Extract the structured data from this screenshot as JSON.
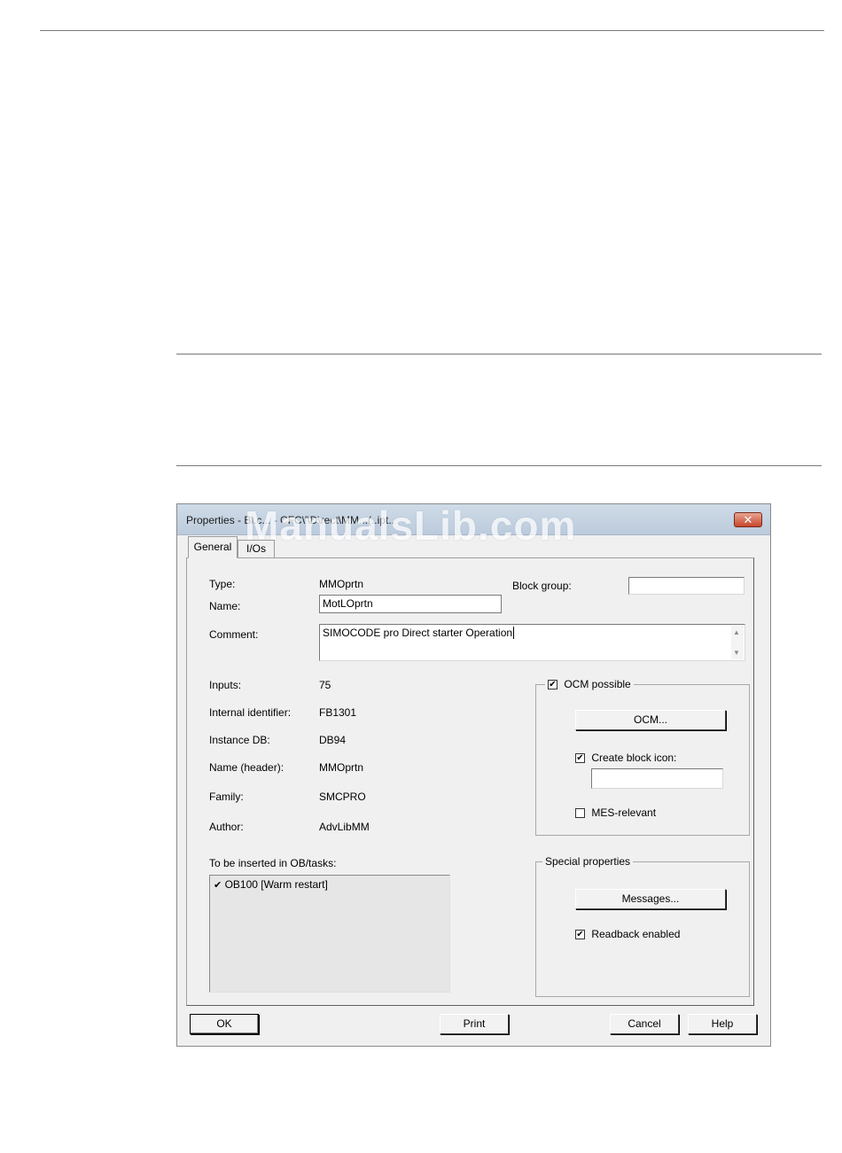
{
  "dialog": {
    "title": "Properties - Bl.c... - CFC\\'\\D\\rect\\MM...(..ipt..",
    "watermark": "ManualsLib.com",
    "close_glyph": "✕",
    "tabs": [
      {
        "label": "General"
      },
      {
        "label": "I/Os"
      }
    ],
    "fields": {
      "type_label": "Type:",
      "type_value": "MMOprtn",
      "block_group_label": "Block group:",
      "block_group_value": "",
      "name_label": "Name:",
      "name_value": "MotLOprtn",
      "comment_label": "Comment:",
      "comment_value": "SIMOCODE pro Direct starter Operation",
      "inputs_label": "Inputs:",
      "inputs_value": "75",
      "internal_id_label": "Internal identifier:",
      "internal_id_value": "FB1301",
      "instance_db_label": "Instance DB:",
      "instance_db_value": "DB94",
      "name_header_label": "Name (header):",
      "name_header_value": "MMOprtn",
      "family_label": "Family:",
      "family_value": "SMCPRO",
      "author_label": "Author:",
      "author_value": "AdvLibMM"
    },
    "ob_tasks": {
      "label": "To be inserted in OB/tasks:",
      "items": [
        "OB100 [Warm restart]"
      ],
      "check_glyph": "✔"
    },
    "ocm_group": {
      "legend": "OCM possible",
      "checked": true,
      "ocm_button": "OCM...",
      "create_block_icon_label": "Create block icon:",
      "create_block_icon_checked": true,
      "block_icon_value": "",
      "mes_relevant_label": "MES-relevant",
      "mes_relevant_checked": false
    },
    "special_group": {
      "legend": "Special properties",
      "messages_button": "Messages...",
      "readback_label": "Readback enabled",
      "readback_checked": true
    },
    "buttons": {
      "ok": "OK",
      "print": "Print",
      "cancel": "Cancel",
      "help": "Help"
    },
    "check_mark": "✔"
  }
}
